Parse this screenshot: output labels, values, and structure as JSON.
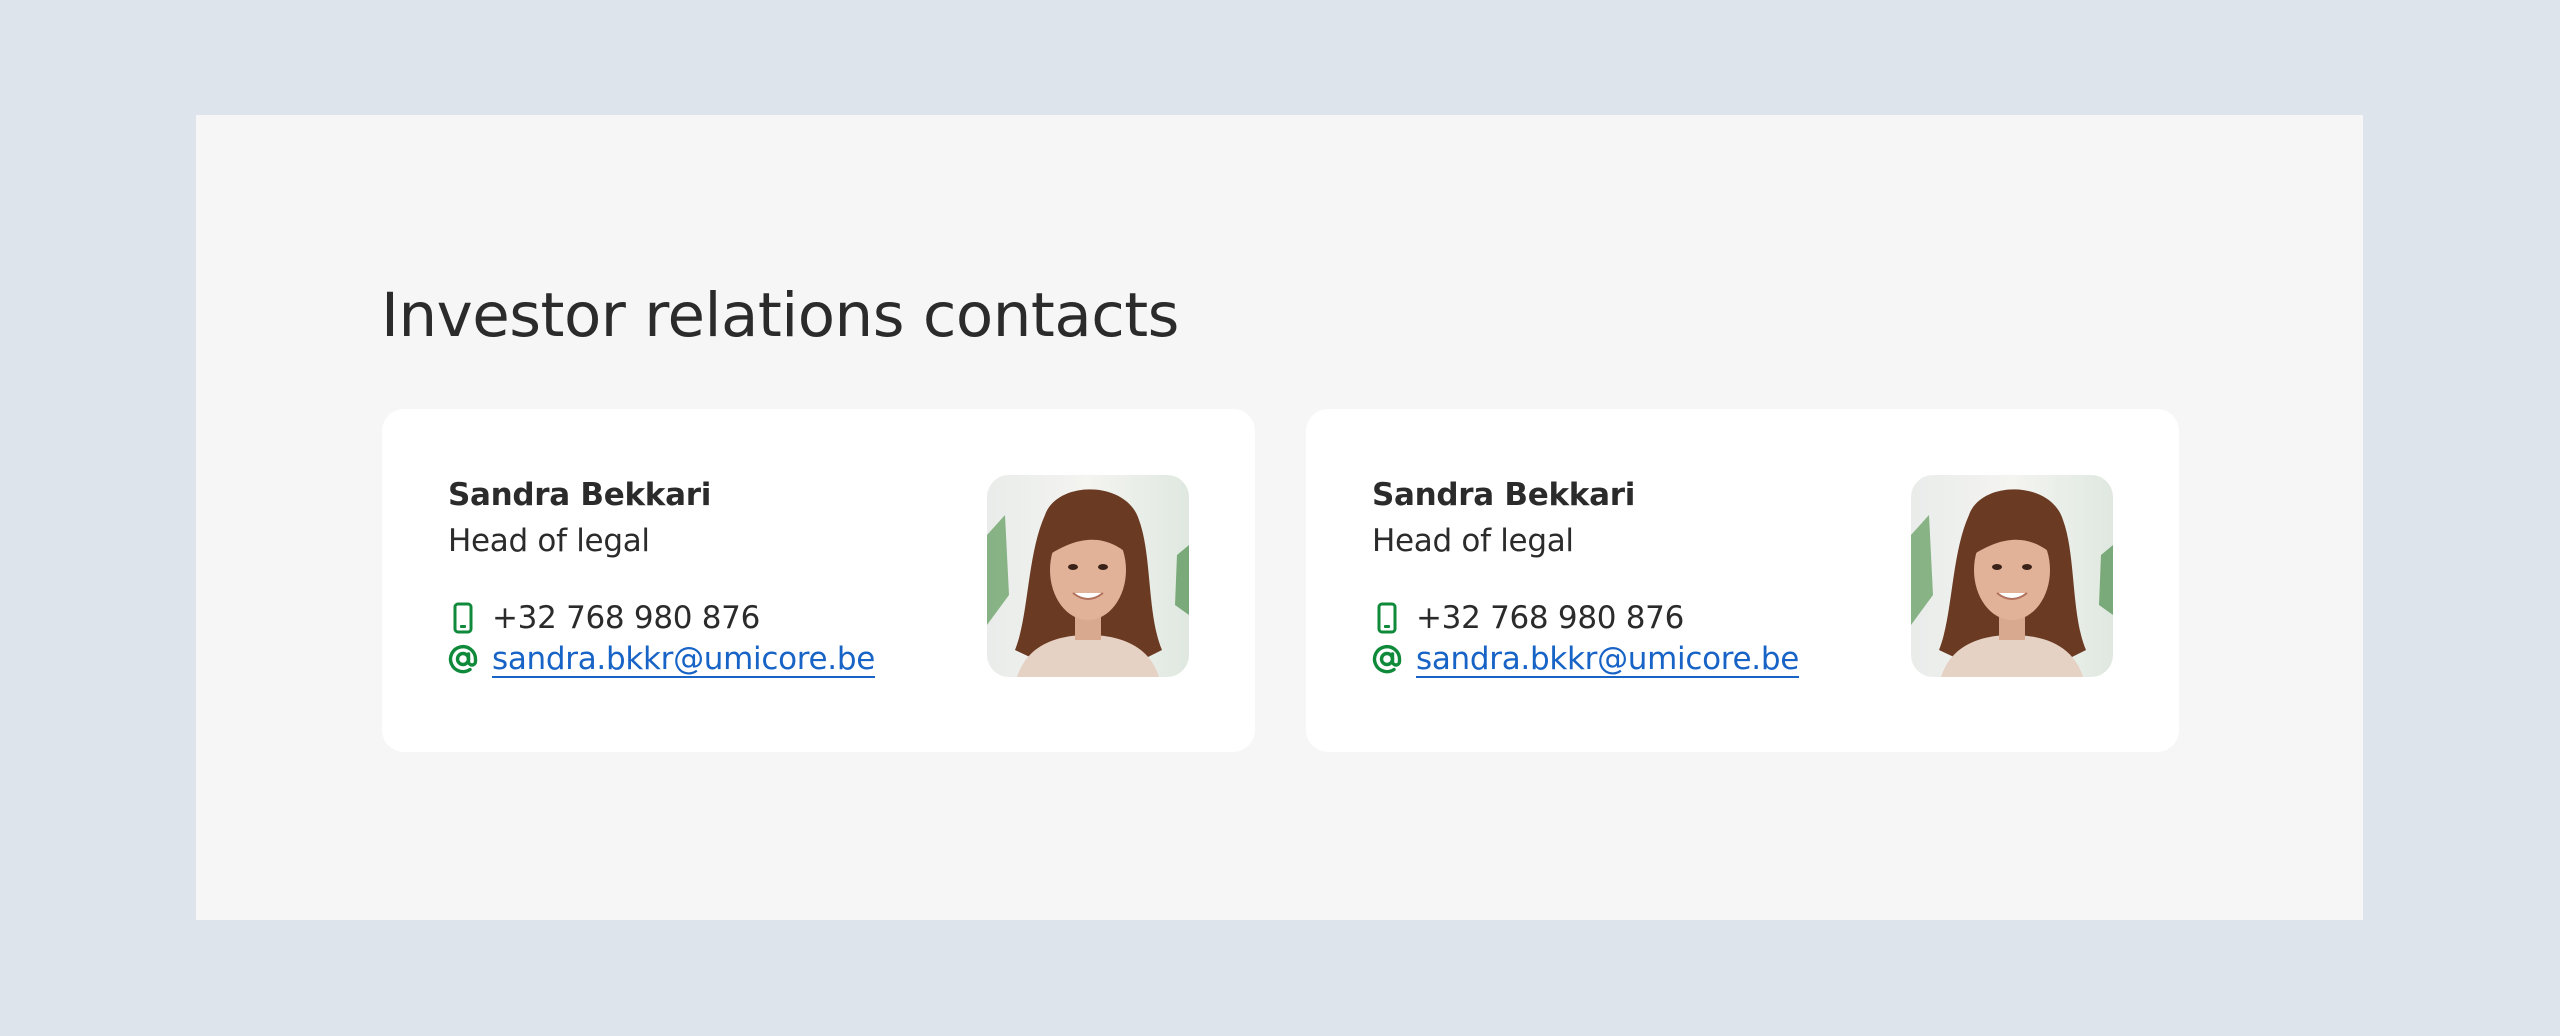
{
  "section": {
    "title": "Investor relations contacts"
  },
  "colors": {
    "page_bg": "#dde4eb",
    "panel_bg": "#f6f6f6",
    "card_bg": "#ffffff",
    "text": "#2b2b2b",
    "link": "#1763c6",
    "icon_accent": "#0f8a3a"
  },
  "contacts": [
    {
      "name": "Sandra Bekkari",
      "role": "Head of legal",
      "phone": "+32 768 980 876",
      "email": "sandra.bkkr@umicore.be",
      "phone_icon": "mobile-phone-icon",
      "email_icon": "at-sign-icon"
    },
    {
      "name": "Sandra Bekkari",
      "role": "Head of legal",
      "phone": "+32 768 980 876",
      "email": "sandra.bkkr@umicore.be",
      "phone_icon": "mobile-phone-icon",
      "email_icon": "at-sign-icon"
    }
  ]
}
